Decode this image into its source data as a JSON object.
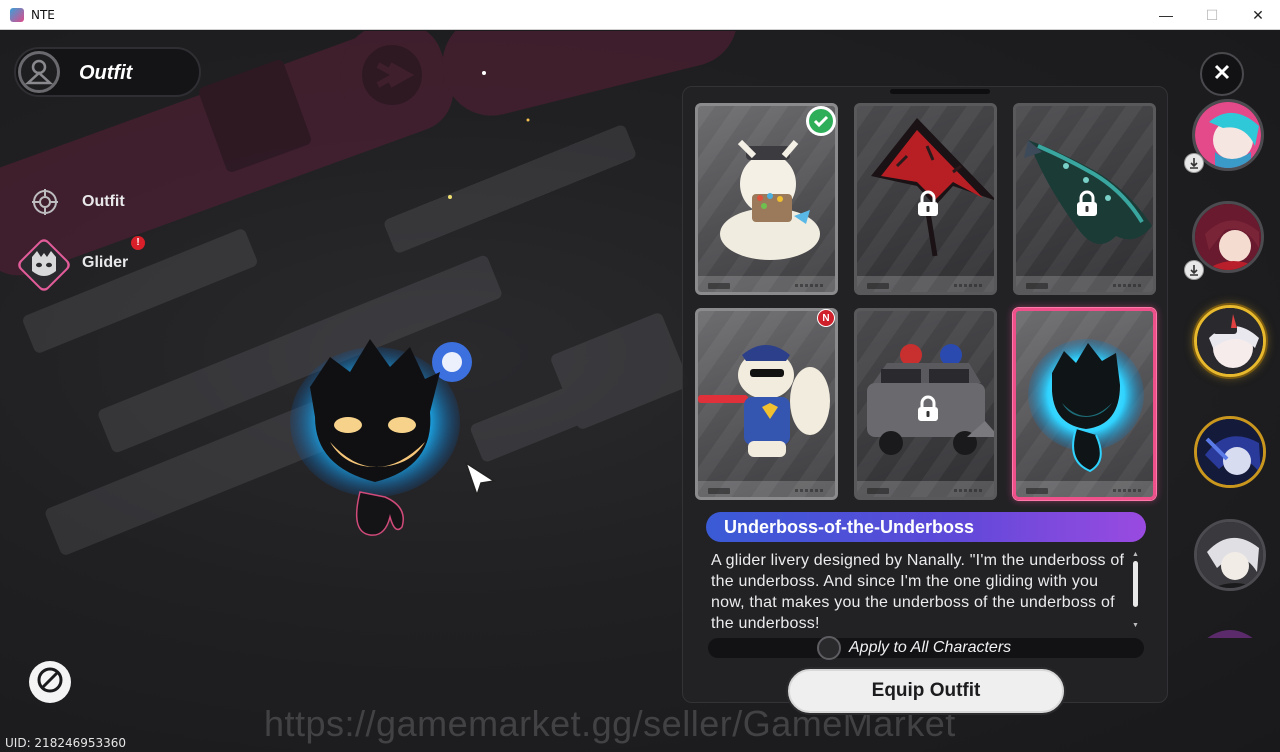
{
  "window": {
    "title": "NTE",
    "minimize": "—",
    "maximize": "☐",
    "close": "✕"
  },
  "header": {
    "title": "Outfit"
  },
  "nav": {
    "items": [
      {
        "label": "Outfit",
        "icon": "crosshair-icon"
      },
      {
        "label": "Glider",
        "icon": "glider-mask-icon",
        "alert": "!"
      }
    ]
  },
  "grid": {
    "cards": [
      {
        "art": "fluffy-creature-with-cap",
        "locked": false,
        "equipped": true,
        "new": false,
        "selected": false
      },
      {
        "art": "red-black-kite-glider",
        "locked": true,
        "equipped": false,
        "new": false,
        "selected": false
      },
      {
        "art": "koi-fish-glider",
        "locked": true,
        "equipped": false,
        "new": false,
        "selected": false
      },
      {
        "art": "police-hamster-glider",
        "locked": false,
        "equipped": false,
        "new": true,
        "new_label": "N",
        "selected": false
      },
      {
        "art": "police-car-glider",
        "locked": true,
        "equipped": false,
        "new": false,
        "selected": false
      },
      {
        "art": "blue-flame-ghost-glider",
        "locked": false,
        "equipped": false,
        "new": false,
        "selected": true
      }
    ]
  },
  "item": {
    "name": "Underboss-of-the-Underboss",
    "description": "A glider livery designed by Nanally. \"I'm the underboss of the underboss. And since I'm the one gliding with you now, that makes you the underboss of the underboss of the underboss!"
  },
  "apply_all": {
    "label": "Apply to All Characters",
    "checked": false
  },
  "equip_button": {
    "label": "Equip Outfit"
  },
  "watermark": "https://gamemarket.gg/seller/GameMarket",
  "uid": "UID: 218246953360",
  "close_icon": "✕",
  "characters": [
    {
      "name": "character-1",
      "download": true
    },
    {
      "name": "character-2",
      "download": true
    },
    {
      "name": "character-3",
      "active": true
    },
    {
      "name": "character-4",
      "active": false
    },
    {
      "name": "character-5",
      "active": false
    }
  ],
  "colors": {
    "accent_pink": "#f0508a",
    "title_gradient_start": "#3a5bd6",
    "title_gradient_end": "#9a4ae0",
    "gold": "#e8b92c",
    "ghost_blue": "#2fd3ff"
  }
}
